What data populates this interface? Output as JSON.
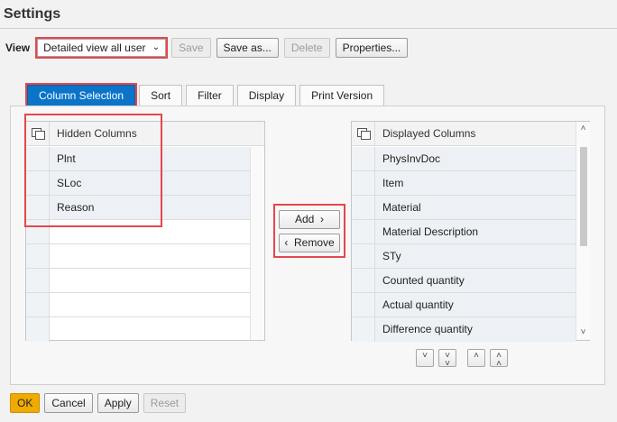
{
  "title": "Settings",
  "view": {
    "label": "View",
    "selected": "Detailed view all user",
    "buttons": {
      "save": "Save",
      "save_as": "Save as...",
      "delete": "Delete",
      "properties": "Properties..."
    }
  },
  "tabs": [
    {
      "label": "Column Selection"
    },
    {
      "label": "Sort"
    },
    {
      "label": "Filter"
    },
    {
      "label": "Display"
    },
    {
      "label": "Print Version"
    }
  ],
  "hidden_columns": {
    "header": "Hidden Columns",
    "items": [
      "Plnt",
      "SLoc",
      "Reason"
    ]
  },
  "transfer": {
    "add": "Add",
    "remove": "Remove"
  },
  "displayed_columns": {
    "header": "Displayed Columns",
    "items": [
      "PhysInvDoc",
      "Item",
      "Material",
      "Material Description",
      "STy",
      "Counted quantity",
      "Actual quantity",
      "Difference quantity"
    ]
  },
  "footer": {
    "ok": "OK",
    "cancel": "Cancel",
    "apply": "Apply",
    "reset": "Reset"
  },
  "colors": {
    "accent": "#0a74c8",
    "ok": "#f0ab00",
    "highlight": "#e4474c"
  }
}
